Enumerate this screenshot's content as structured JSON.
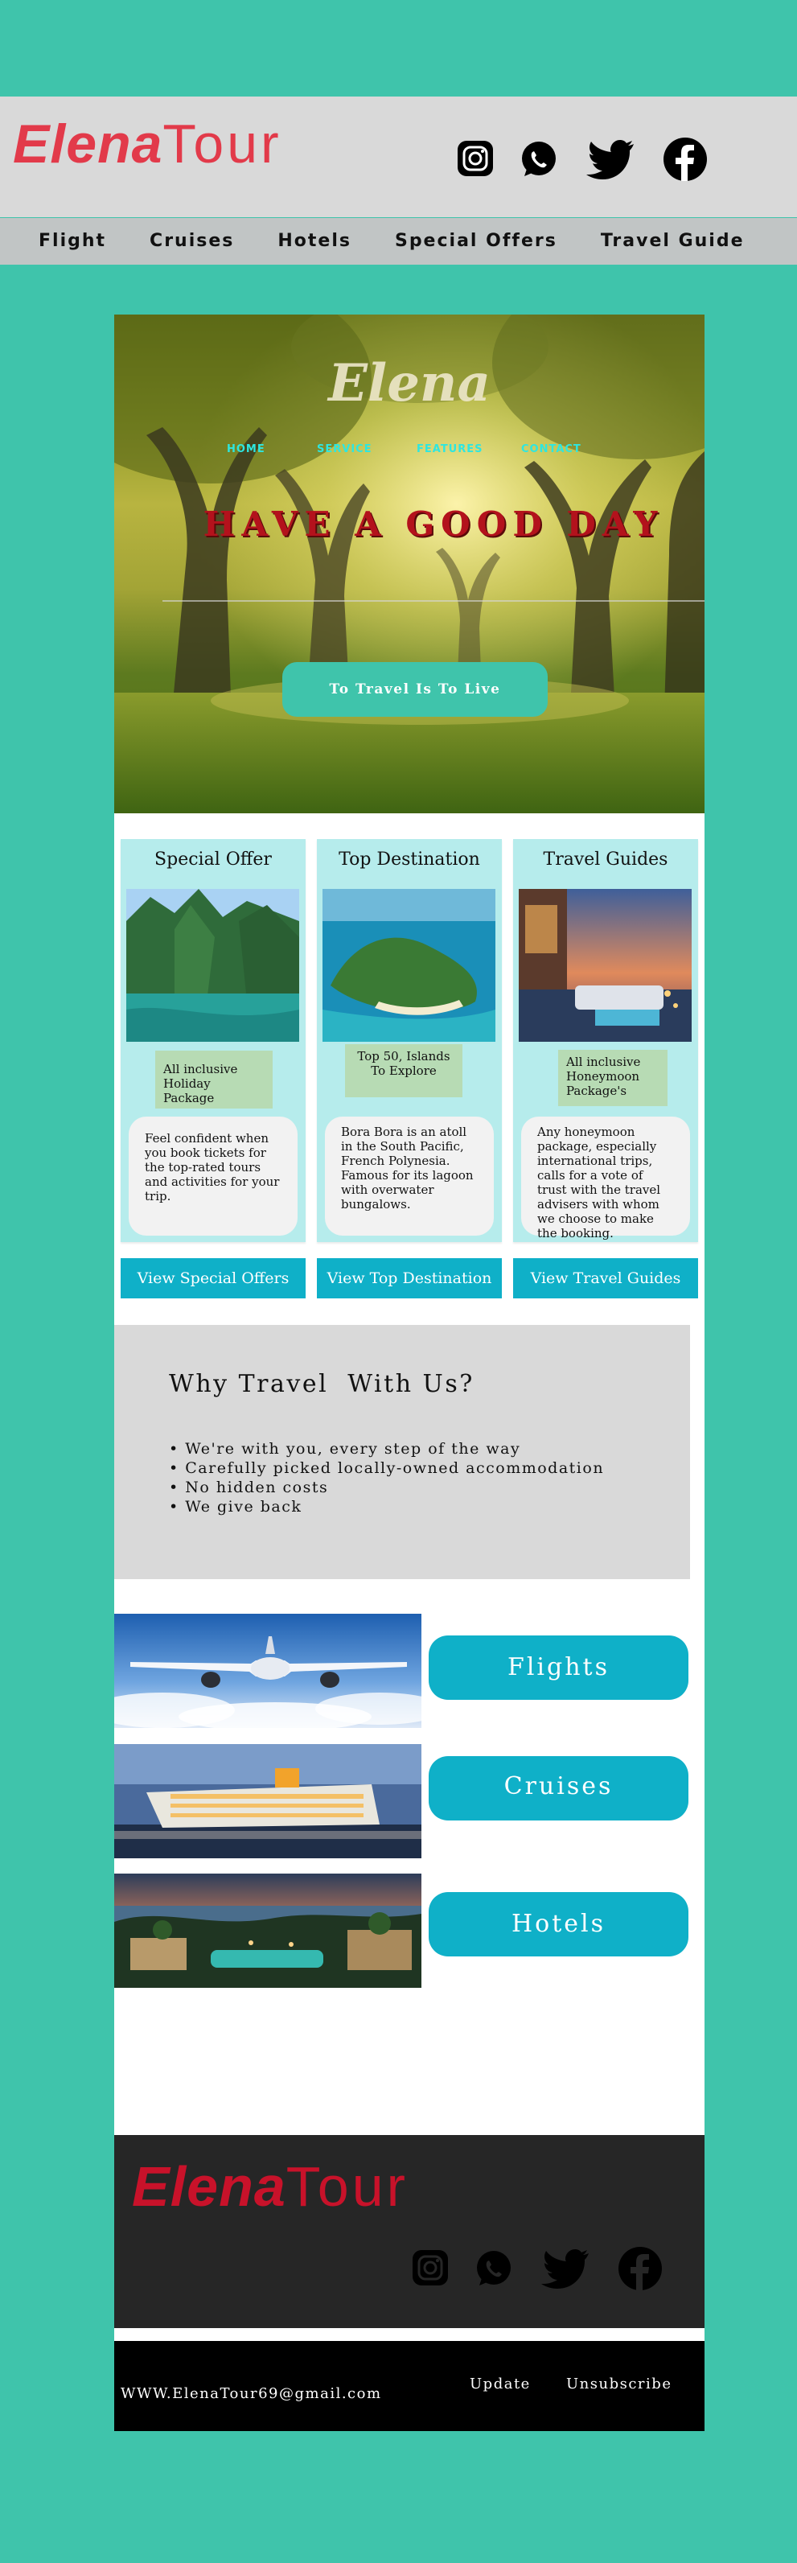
{
  "header": {
    "brand_part1": "Elena",
    "brand_part2": "Tour",
    "brand_color": "#e23a4a",
    "social": [
      "instagram-icon",
      "whatsapp-icon",
      "twitter-icon",
      "facebook-icon"
    ]
  },
  "nav": {
    "items": [
      "Flight",
      "Cruises",
      "Hotels",
      "Special Offers",
      "Travel Guide"
    ]
  },
  "hero": {
    "logo": "Elena",
    "menu": [
      "HOME",
      "SERVICE",
      "FEATURES",
      "CONTACT"
    ],
    "headline": "HAVE A GOOD DAY",
    "button": "To Travel Is To Live"
  },
  "cards": [
    {
      "title": "Special Offer",
      "tag": "All inclusive Holiday Package",
      "text": "Feel confident when you book tickets for the top-rated tours and activities for your trip.",
      "cta": "View Special Offers"
    },
    {
      "title": "Top Destination",
      "tag": "Top 50, Islands To Explore",
      "text": "Bora Bora is an atoll in the South Pacific, French Polynesia. Famous for its lagoon with overwater bungalows.",
      "cta": "View Top Destination"
    },
    {
      "title": "Travel Guides",
      "tag": "All inclusive Honeymoon Package's",
      "text": "Any honeymoon package, especially international trips, calls for a vote of trust with the travel advisers with whom we choose to make the booking.",
      "cta": "View Travel Guides"
    }
  ],
  "why": {
    "title": "Why Travel  With Us?",
    "points": [
      "We're with you, every step of the way",
      "Carefully picked locally-owned accommodation",
      "No hidden costs",
      "We give back"
    ]
  },
  "services": [
    "Flights",
    "Cruises",
    "Hotels"
  ],
  "footer": {
    "brand_part1": "Elena",
    "brand_part2": "Tour",
    "email": "WWW.ElenaTour69@gmail.com",
    "update": "Update",
    "unsubscribe": "Unsubscribe"
  },
  "colors": {
    "page_bg": "#3fc4ab",
    "accent": "#0fb0c8",
    "card_bg": "#b6ecec",
    "headline": "#b3121c"
  }
}
